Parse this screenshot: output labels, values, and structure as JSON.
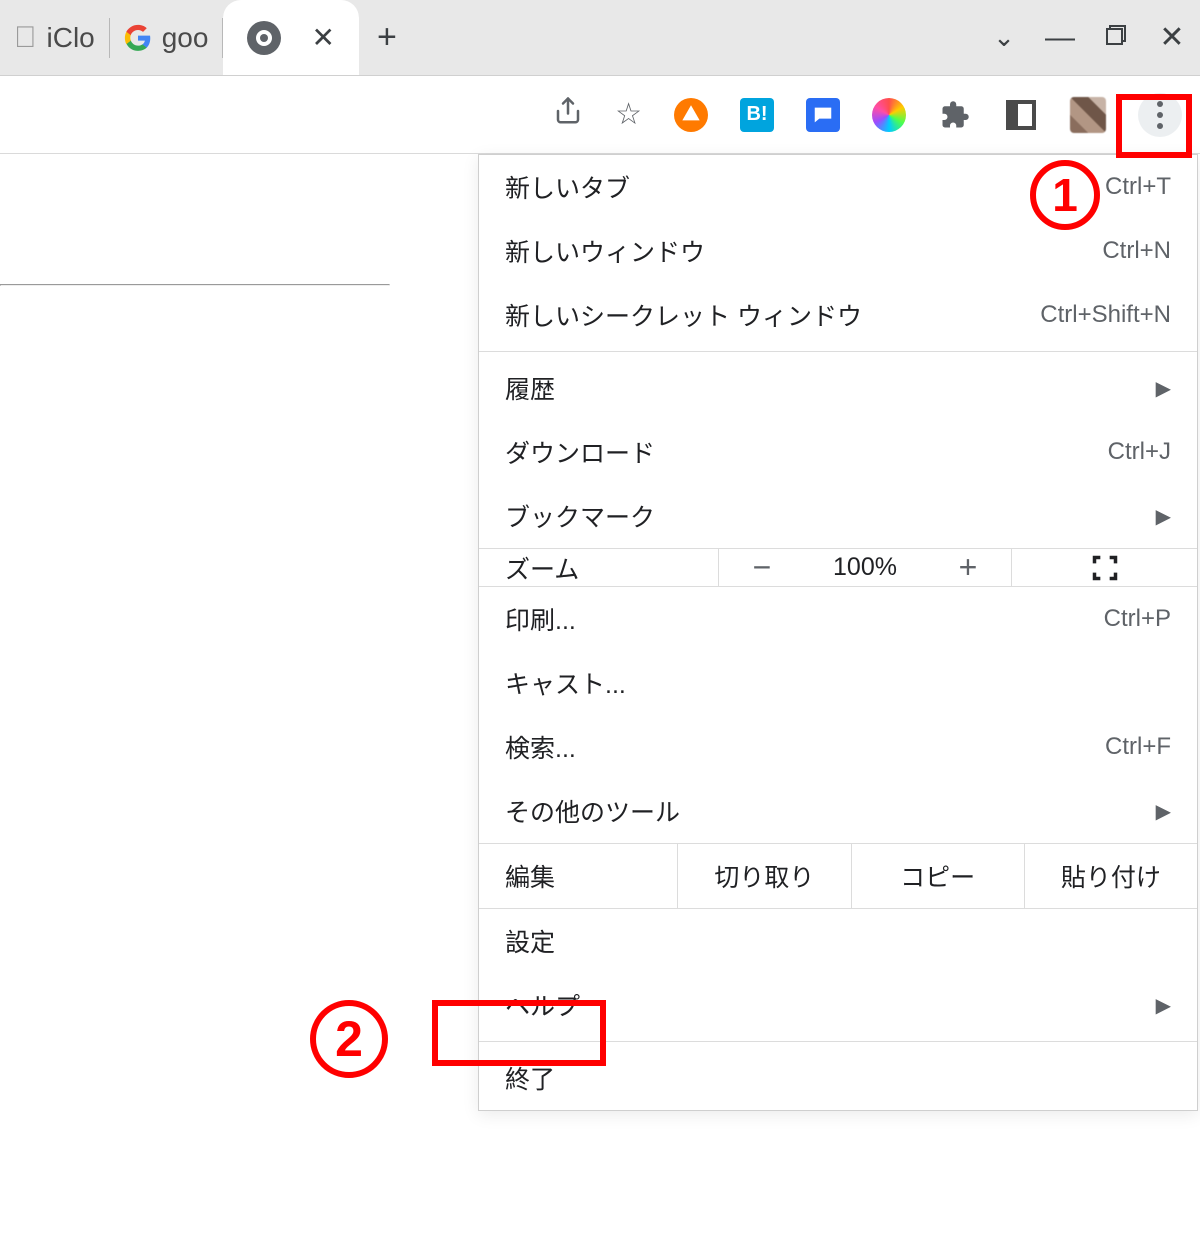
{
  "tabs": {
    "icloud_label": "iClo",
    "google_label": "goo"
  },
  "window_controls": {
    "minimize": "—",
    "maximize": "❐",
    "close": "✕"
  },
  "toolbar": {
    "ext_hatena_label": "B!"
  },
  "menu": {
    "new_tab": {
      "label": "新しいタブ",
      "accel": "Ctrl+T"
    },
    "new_window": {
      "label": "新しいウィンドウ",
      "accel": "Ctrl+N"
    },
    "new_incognito": {
      "label": "新しいシークレット ウィンドウ",
      "accel": "Ctrl+Shift+N"
    },
    "history": {
      "label": "履歴"
    },
    "downloads": {
      "label": "ダウンロード",
      "accel": "Ctrl+J"
    },
    "bookmarks": {
      "label": "ブックマーク"
    },
    "zoom": {
      "label": "ズーム",
      "value": "100%"
    },
    "print": {
      "label": "印刷...",
      "accel": "Ctrl+P"
    },
    "cast": {
      "label": "キャスト..."
    },
    "find": {
      "label": "検索...",
      "accel": "Ctrl+F"
    },
    "more_tools": {
      "label": "その他のツール"
    },
    "edit": {
      "label": "編集",
      "cut": "切り取り",
      "copy": "コピー",
      "paste": "貼り付け"
    },
    "settings": {
      "label": "設定"
    },
    "help": {
      "label": "ヘルプ"
    },
    "exit": {
      "label": "終了"
    }
  },
  "callouts": {
    "one": "1",
    "two": "2"
  }
}
